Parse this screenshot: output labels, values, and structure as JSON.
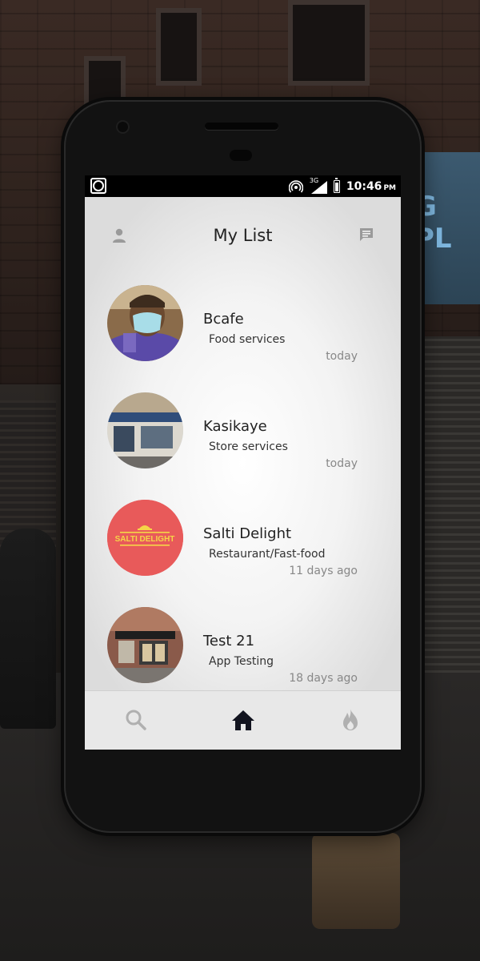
{
  "status_bar": {
    "network": "3G",
    "time": "10:46",
    "ampm": "PM"
  },
  "header": {
    "title": "My List",
    "left_icon": "person-icon",
    "right_icon": "chat-icon"
  },
  "items": [
    {
      "name": "Bcafe",
      "category": "Food services",
      "time": "today",
      "avatar": "photo"
    },
    {
      "name": "Kasikaye",
      "category": "Store services",
      "time": "today",
      "avatar": "photo"
    },
    {
      "name": "Salti Delight",
      "category": "Restaurant/Fast-food",
      "time": "11 days ago",
      "avatar": "logo",
      "logo_text": "SALTI DELIGHT"
    },
    {
      "name": "Test 21",
      "category": "App Testing",
      "time": "18 days ago",
      "avatar": "photo"
    }
  ],
  "bottom_nav": {
    "items": [
      "search-icon",
      "home-icon",
      "flame-icon"
    ],
    "active": "home-icon"
  },
  "colors": {
    "accent_red": "#e85a5a",
    "nav_active": "#12141f",
    "nav_inactive": "#b0b0b0"
  }
}
